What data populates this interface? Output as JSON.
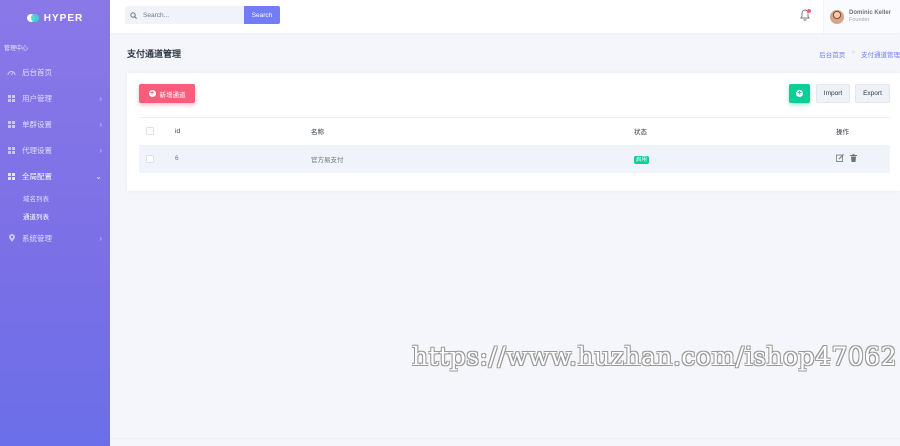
{
  "brand": {
    "name": "HYPER"
  },
  "sidebar": {
    "section_title": "管理中心",
    "items": [
      {
        "label": "后台首页",
        "icon": "dashboard-icon",
        "has_arrow": false
      },
      {
        "label": "用户管理",
        "icon": "grid-icon",
        "has_arrow": true
      },
      {
        "label": "单群设置",
        "icon": "grid-icon",
        "has_arrow": true
      },
      {
        "label": "代理设置",
        "icon": "grid-icon",
        "has_arrow": true
      },
      {
        "label": "全局配置",
        "icon": "grid-icon",
        "has_arrow": true,
        "expanded": true
      },
      {
        "label": "系统管理",
        "icon": "location-pin-icon",
        "has_arrow": true
      }
    ],
    "submenu": [
      {
        "label": "域名列表"
      },
      {
        "label": "通道列表",
        "active": true
      }
    ]
  },
  "topbar": {
    "search_placeholder": "Search...",
    "search_button": "Search",
    "user": {
      "name": "Dominic Keller",
      "role": "Founder"
    }
  },
  "page": {
    "title": "支付通道管理",
    "breadcrumb": [
      "后台首页",
      ">",
      "支付通道管理"
    ]
  },
  "toolbar": {
    "add_label": "新增通道",
    "import_label": "Import",
    "export_label": "Export"
  },
  "table": {
    "headers": [
      "id",
      "名称",
      "状态",
      "操作"
    ],
    "rows": [
      {
        "id": "6",
        "name": "官方易支付",
        "status": "启用"
      }
    ]
  },
  "colors": {
    "primary": "#727cf5",
    "danger": "#fa5c7c",
    "success": "#0acf97"
  },
  "watermark": "https://www.huzhan.com/ishop47062"
}
